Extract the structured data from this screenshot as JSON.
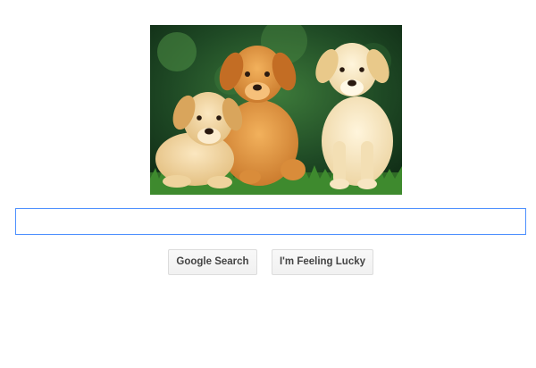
{
  "logo": {
    "icon": "labrador-puppies-photo"
  },
  "search": {
    "value": "",
    "placeholder": ""
  },
  "buttons": {
    "search_label": "Google Search",
    "lucky_label": "I'm Feeling Lucky"
  },
  "colors": {
    "input_border": "#4d90fe",
    "button_bg": "#f2f2f2",
    "button_text": "#444444"
  }
}
